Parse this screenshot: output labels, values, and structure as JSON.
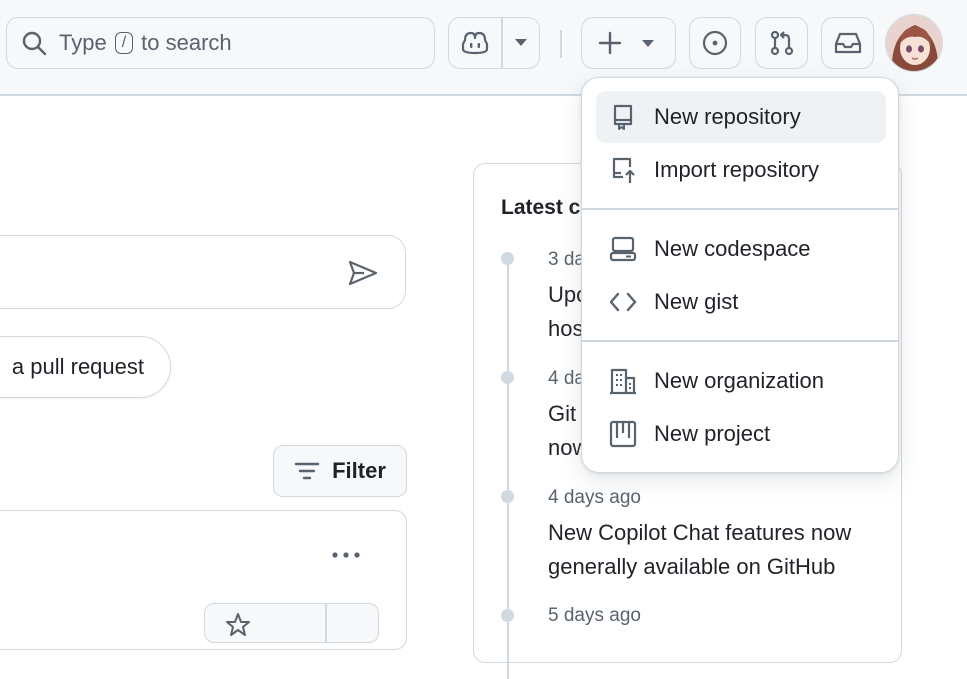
{
  "header": {
    "search": {
      "prefix": "Type",
      "key": "/",
      "suffix": "to search"
    },
    "icons": {
      "copilot": "copilot-icon",
      "create": "plus-icon",
      "issues": "issue-opened-icon",
      "pulls": "git-pull-request-icon",
      "inbox": "inbox-icon"
    }
  },
  "main": {
    "suggestion_pill": "a pull request",
    "filter_label": "Filter"
  },
  "changelog": {
    "title": "Latest c",
    "entries": [
      {
        "date": "3 da",
        "line1": "Upo",
        "line2": "hos"
      },
      {
        "date": "4 da",
        "line1": "Git",
        "line2": "now"
      },
      {
        "date": "4 days ago",
        "line1": "New Copilot Chat features now",
        "line2": "generally available on GitHub"
      },
      {
        "date": "5 days ago"
      }
    ]
  },
  "create_menu": {
    "items": [
      {
        "label": "New repository",
        "icon": "repo-icon",
        "active": true
      },
      {
        "label": "Import repository",
        "icon": "repo-push-icon"
      },
      {
        "label": "New codespace",
        "icon": "codespaces-icon"
      },
      {
        "label": "New gist",
        "icon": "code-icon"
      },
      {
        "label": "New organization",
        "icon": "organization-icon"
      },
      {
        "label": "New project",
        "icon": "project-icon"
      }
    ]
  },
  "colors": {
    "header_bg": "#f6f8fa",
    "border": "#d1d9e0",
    "text": "#1f2328",
    "muted": "#59636e",
    "menu_active": "#eff2f5"
  }
}
